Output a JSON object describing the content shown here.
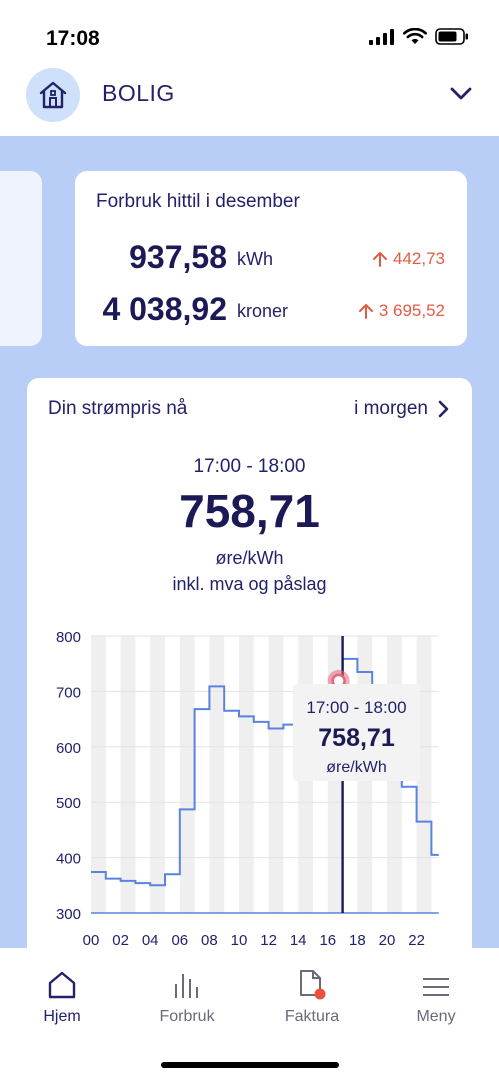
{
  "status": {
    "time": "17:08"
  },
  "header": {
    "title": "BOLIG",
    "icon": "house-icon"
  },
  "summary": {
    "title": "Forbruk hittil i desember",
    "kwh_value": "937,58",
    "kwh_unit": "kWh",
    "kwh_delta": "442,73",
    "kr_value": "4 038,92",
    "kr_unit": "kroner",
    "kr_delta": "3 695,52",
    "delta_color": "#e35b45"
  },
  "price": {
    "title": "Din strømpris nå",
    "tomorrow_label": "i morgen",
    "time_range": "17:00 - 18:00",
    "value": "758,71",
    "unit": "øre/kWh",
    "note": "inkl. mva og påslag"
  },
  "tooltip": {
    "time_range": "17:00  - 18:00",
    "value": "758,71",
    "unit": "øre/kWh"
  },
  "chart_data": {
    "type": "line",
    "step": true,
    "x": [
      0,
      1,
      2,
      3,
      4,
      5,
      6,
      7,
      8,
      9,
      10,
      11,
      12,
      13,
      14,
      15,
      16,
      17,
      18,
      19,
      20,
      21,
      22,
      23
    ],
    "x_tick_labels": [
      "00",
      "02",
      "04",
      "06",
      "08",
      "10",
      "12",
      "14",
      "16",
      "18",
      "20",
      "22"
    ],
    "y_tick_labels": [
      "800",
      "700",
      "600",
      "500",
      "400",
      "300"
    ],
    "ylim": [
      300,
      800
    ],
    "xlim": [
      0,
      23.5
    ],
    "series": [
      {
        "values": [
          374,
          362,
          358,
          354,
          350,
          370,
          487,
          668,
          709,
          665,
          655,
          645,
          633,
          640,
          648,
          660,
          700,
          758.71,
          735,
          700,
          620,
          528,
          465,
          405
        ]
      }
    ],
    "highlight_hour": 17,
    "line_color": "#5b82de",
    "cursor_color": "#1b1a57",
    "marker_color": "#e3667a",
    "stripe_color": "#efefef"
  },
  "nav": {
    "items": [
      {
        "label": "Hjem",
        "icon": "home-icon"
      },
      {
        "label": "Forbruk",
        "icon": "bar-chart-icon"
      },
      {
        "label": "Faktura",
        "icon": "invoice-icon"
      },
      {
        "label": "Meny",
        "icon": "menu-icon"
      }
    ],
    "active_color": "#23216b",
    "badge_color": "#e8523f"
  }
}
